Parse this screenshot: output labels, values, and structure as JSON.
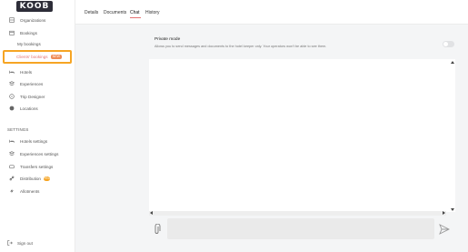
{
  "app": {
    "logo_text": "KOOB"
  },
  "sidebar": {
    "items": [
      {
        "label": "Organizations",
        "icon": "building-icon"
      },
      {
        "label": "Bookings",
        "icon": "calendar-icon"
      },
      {
        "label": "My bookings"
      },
      {
        "label": "Clients' bookings",
        "badge": "NEW"
      },
      {
        "label": "Hotels",
        "icon": "bed-icon"
      },
      {
        "label": "Experiences",
        "icon": "layers-icon"
      },
      {
        "label": "Trip Designer",
        "icon": "compass-icon"
      },
      {
        "label": "Locations",
        "icon": "globe-icon"
      }
    ],
    "settings_label": "SETTINGS",
    "settings_items": [
      {
        "label": "Hotels settings",
        "icon": "bed-icon"
      },
      {
        "label": "Experiences settings",
        "icon": "layers-icon"
      },
      {
        "label": "Transfers settings",
        "icon": "car-icon"
      },
      {
        "label": "Distribution",
        "icon": "link-icon",
        "badge": "PRO"
      },
      {
        "label": "Allotments",
        "icon": "lightning-icon"
      }
    ],
    "signout_label": "Sign out"
  },
  "tabs": [
    {
      "label": "Details"
    },
    {
      "label": "Documents"
    },
    {
      "label": "Chat",
      "active": true
    },
    {
      "label": "History"
    }
  ],
  "private_mode": {
    "title": "Private mode",
    "description": "Allows you to send messages and documents to the hotel keeper only. Your operators won't be able to see them.",
    "enabled": false
  },
  "composer": {
    "value": "",
    "placeholder": ""
  },
  "colors": {
    "accent": "#e57373",
    "highlight": "#f6a524",
    "badge": "#ef8c57"
  }
}
